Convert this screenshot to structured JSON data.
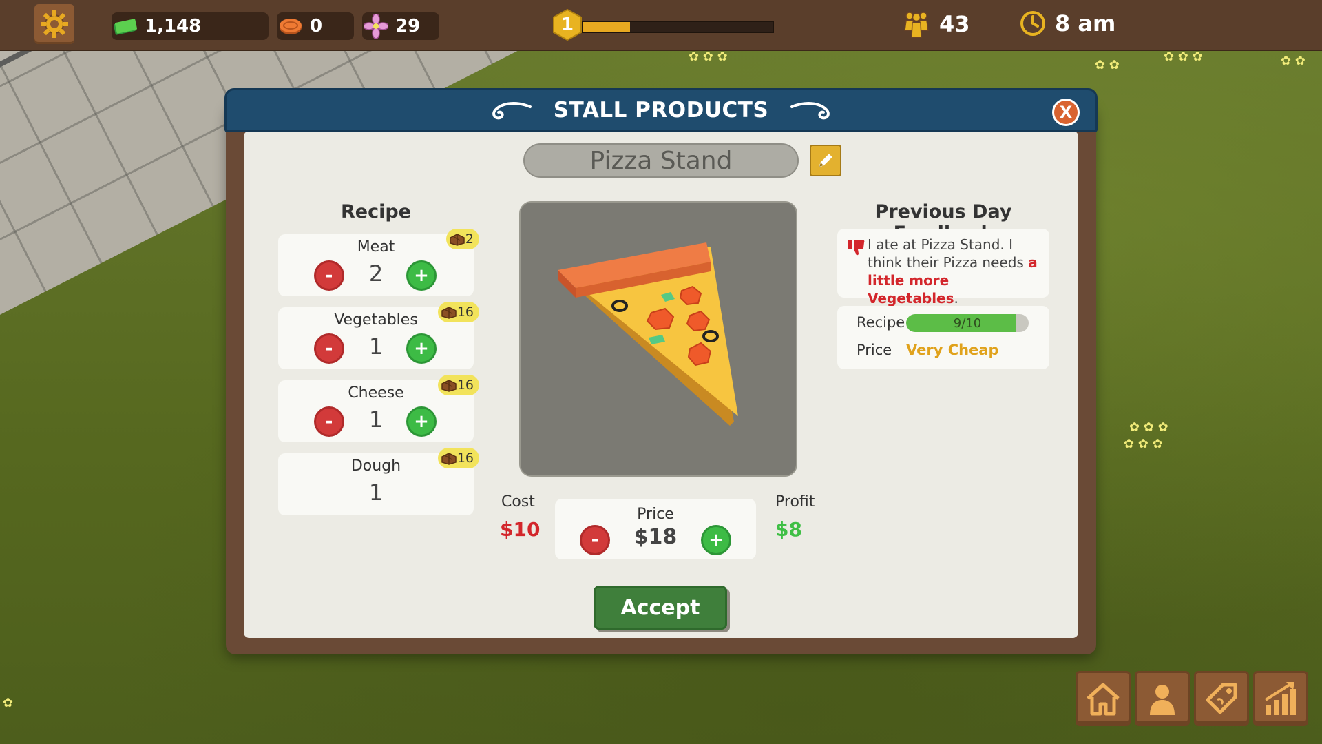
{
  "topbar": {
    "money": "1,148",
    "coins": "0",
    "flowers": "29",
    "level": "1",
    "xp_progress": 0.25,
    "population": "43",
    "time": "8 am"
  },
  "dialog": {
    "title": "STALL PRODUCTS",
    "stall_name": "Pizza Stand",
    "recipe_title": "Recipe",
    "ingredients": [
      {
        "name": "Meat",
        "qty": "2",
        "stock": "2"
      },
      {
        "name": "Vegetables",
        "qty": "1",
        "stock": "16"
      },
      {
        "name": "Cheese",
        "qty": "1",
        "stock": "16"
      },
      {
        "name": "Dough",
        "qty": "1",
        "stock": "16"
      }
    ],
    "minus": "-",
    "plus": "+",
    "cost_label": "Cost",
    "cost_value": "$10",
    "price_label": "Price",
    "price_value": "$18",
    "profit_label": "Profit",
    "profit_value": "$8",
    "accept": "Accept",
    "close": "X",
    "feedback_title": "Previous Day Feedback",
    "feedback_text": "I ate at Pizza Stand. I think their Pizza needs",
    "feedback_highlight": "a little more Vegetables",
    "feedback_end": ".",
    "stat_recipe_label": "Recipe",
    "stat_recipe_value": "9/10",
    "stat_recipe_fraction": 0.9,
    "stat_price_label": "Price",
    "stat_price_value": "Very Cheap"
  },
  "colors": {
    "cost": "#d3262b",
    "profit": "#3fbf45",
    "price_rating": "#e0a21c"
  },
  "bottom_menu": [
    "home-icon",
    "person-icon",
    "price-tag-icon",
    "stats-icon"
  ]
}
